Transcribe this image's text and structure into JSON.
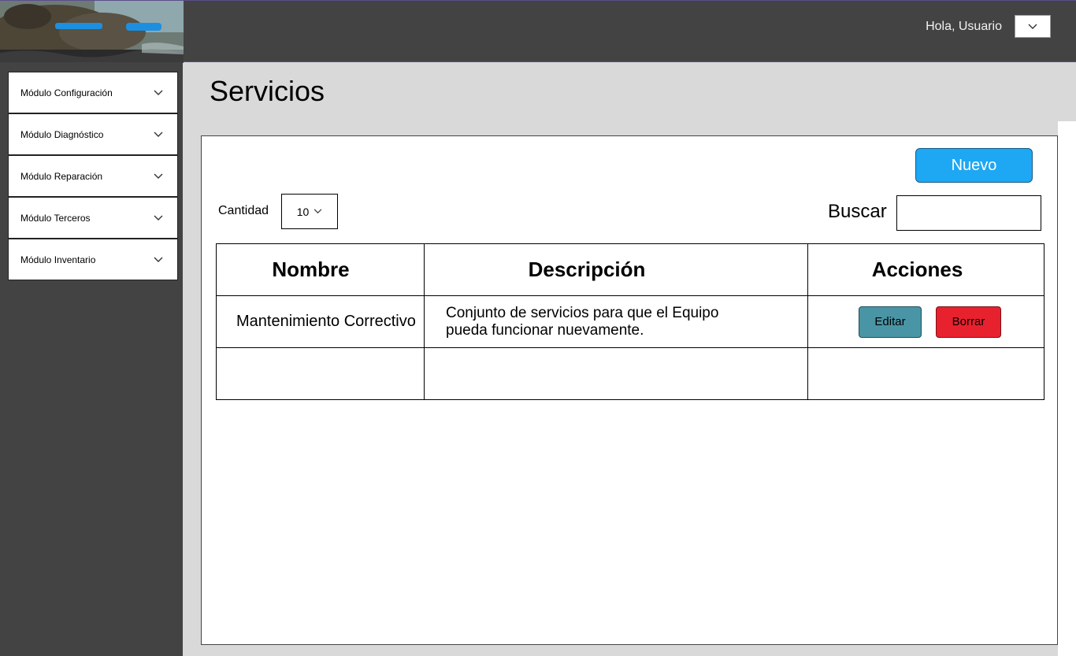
{
  "header": {
    "greeting": "Hola, Usuario",
    "user_menu_icon": "chevron-down-icon"
  },
  "sidebar": {
    "items": [
      {
        "label": "Módulo Configuración"
      },
      {
        "label": "Módulo Diagnóstico"
      },
      {
        "label": "Módulo Reparación"
      },
      {
        "label": "Módulo Terceros"
      },
      {
        "label": "Módulo Inventario"
      }
    ]
  },
  "page": {
    "title": "Servicios"
  },
  "toolbar": {
    "new_label": "Nuevo",
    "quantity_label": "Cantidad",
    "quantity_value": "10",
    "search_label": "Buscar",
    "search_value": ""
  },
  "table": {
    "headers": [
      "Nombre",
      "Descripción",
      "Acciones"
    ],
    "rows": [
      {
        "name": "Mantenimiento Correctivo",
        "description_line1": "Conjunto de servicios para que el Equipo",
        "description_line2": "pueda funcionar nuevamente.",
        "edit_label": "Editar",
        "delete_label": "Borrar"
      }
    ]
  },
  "colors": {
    "header_bg": "#434343",
    "content_bg": "#d9d9d9",
    "new_button": "#1ea7f3",
    "edit_button": "#4a95a5",
    "delete_button": "#e8212e"
  }
}
